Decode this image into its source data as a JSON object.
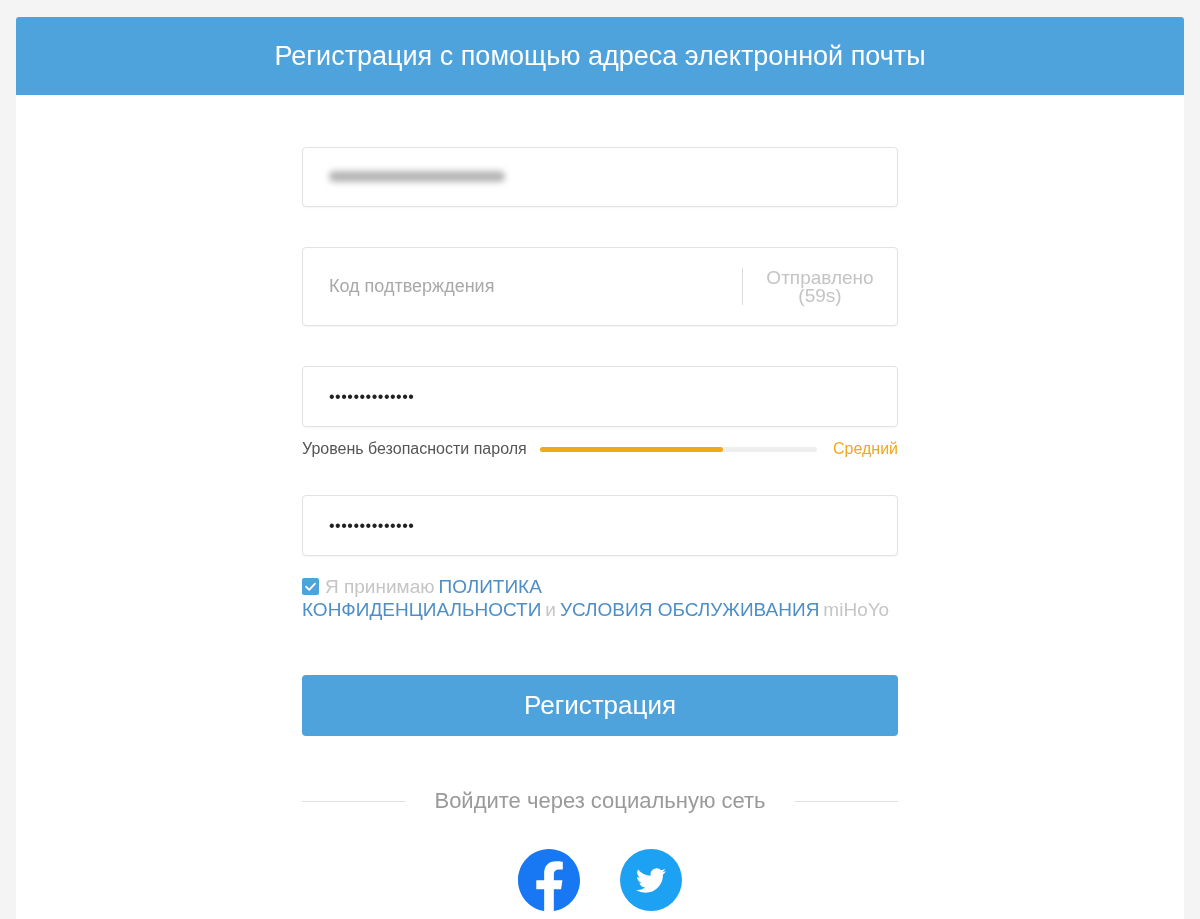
{
  "header": {
    "title": "Регистрация с помощью адреса электронной почты"
  },
  "email": {
    "blurred": true
  },
  "verification_code": {
    "placeholder": "Код подтверждения",
    "resend": "Отправлено (59s)"
  },
  "password": {
    "value": "••••••••••••••"
  },
  "password_strength": {
    "label": "Уровень безопасности пароля",
    "level": 0.66,
    "rating": "Средний"
  },
  "confirm_password": {
    "value": "••••••••••••••"
  },
  "agreement": {
    "checked": true,
    "lines": [
      [
        {
          "kind": "text",
          "text": "Я принимаю"
        },
        {
          "kind": "link",
          "text": "ПОЛИТИКА"
        }
      ],
      [
        {
          "kind": "link",
          "text": "КОНФИДЕНЦИАЛЬНОСТИ"
        },
        {
          "kind": "text",
          "text": "и"
        },
        {
          "kind": "link",
          "text": "УСЛОВИЯ ОБСЛУЖИВАНИЯ"
        },
        {
          "kind": "text",
          "text": "miHoYo"
        }
      ]
    ]
  },
  "register_button": {
    "label": "Регистрация"
  },
  "social_login": {
    "label": "Войдите через социальную сеть"
  }
}
